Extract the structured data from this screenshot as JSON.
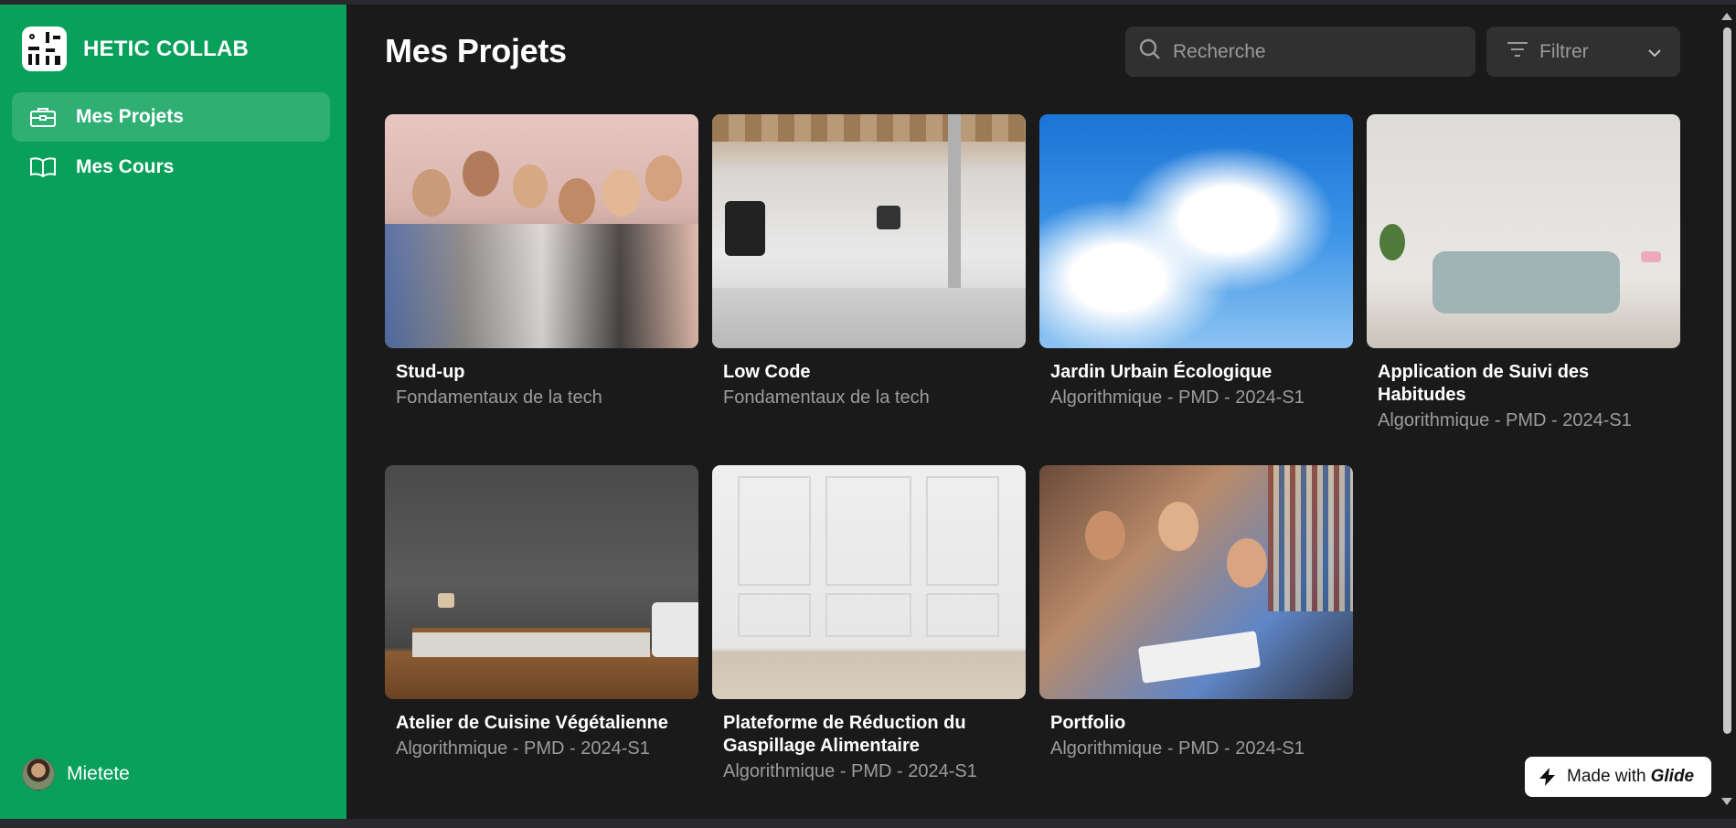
{
  "brand": {
    "name": "HETIC COLLAB"
  },
  "nav": {
    "items": [
      {
        "label": "Mes Projets",
        "active": true,
        "icon": "briefcase-icon"
      },
      {
        "label": "Mes Cours",
        "active": false,
        "icon": "book-icon"
      }
    ]
  },
  "user": {
    "name": "Mietete"
  },
  "header": {
    "title": "Mes Projets",
    "search_placeholder": "Recherche",
    "filter_label": "Filtrer"
  },
  "projects": [
    {
      "title": "Stud-up",
      "subtitle": "Fondamentaux de la tech",
      "image": "group-photo"
    },
    {
      "title": "Low Code",
      "subtitle": "Fondamentaux de la tech",
      "image": "studio-photo"
    },
    {
      "title": "Jardin Urbain Écologique",
      "subtitle": "Algorithmique - PMD - 2024-S1",
      "image": "sky-photo"
    },
    {
      "title": "Application de Suivi des Habitudes",
      "subtitle": "Algorithmique - PMD - 2024-S1",
      "image": "sofa-photo"
    },
    {
      "title": "Atelier de Cuisine Végétalienne",
      "subtitle": "Algorithmique - PMD - 2024-S1",
      "image": "concrete-room-photo"
    },
    {
      "title": "Plateforme de Réduction du Gaspillage Alimentaire",
      "subtitle": "Algorithmique - PMD - 2024-S1",
      "image": "white-wall-photo"
    },
    {
      "title": "Portfolio",
      "subtitle": "Algorithmique - PMD - 2024-S1",
      "image": "students-photo"
    }
  ],
  "badge": {
    "prefix": "Made with",
    "brand": "Glide"
  },
  "colors": {
    "sidebar": "#08a05a",
    "background": "#1a1a1a",
    "field": "#303030"
  }
}
